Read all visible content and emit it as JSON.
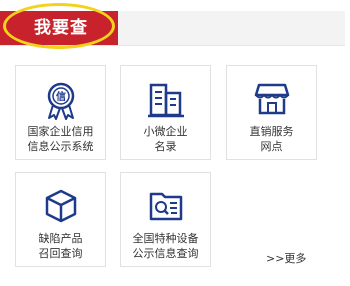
{
  "header": {
    "title": "我要查",
    "accent_color": "#c8232c",
    "highlight_color": "#f3d21b"
  },
  "tiles": [
    {
      "icon": "certificate-icon",
      "line1": "国家企业信用",
      "line2": "信息公示系统"
    },
    {
      "icon": "buildings-icon",
      "line1": "小微企业",
      "line2": "名录"
    },
    {
      "icon": "storefront-icon",
      "line1": "直销服务",
      "line2": "网点"
    },
    {
      "icon": "cube-icon",
      "line1": "缺陷产品",
      "line2": "召回查询"
    },
    {
      "icon": "search-folder-icon",
      "line1": "全国特种设备",
      "line2": "公示信息查询"
    }
  ],
  "more_label": ">>更多",
  "icon_color": "#1f3a8a"
}
